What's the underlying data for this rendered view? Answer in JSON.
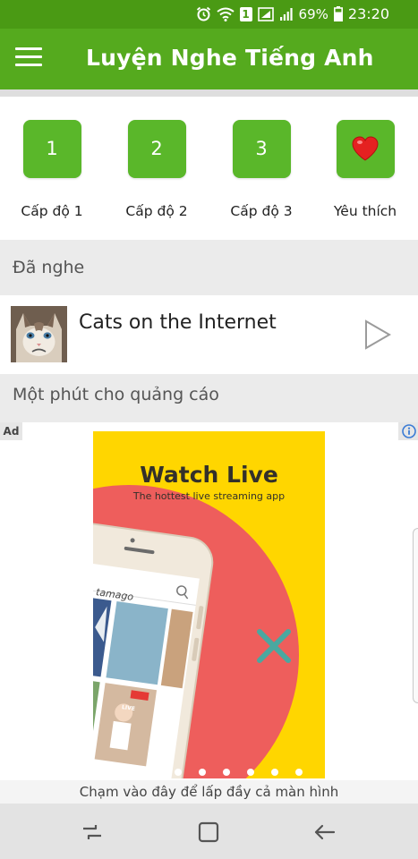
{
  "status_bar": {
    "battery": "69%",
    "time": "23:20",
    "sim_label": "1",
    "icons": [
      "alarm-icon",
      "wifi-icon",
      "sim-icon",
      "signal-icon",
      "battery-icon"
    ]
  },
  "app_bar": {
    "title": "Luyện Nghe Tiếng Anh",
    "menu_icon": "hamburger-menu-icon"
  },
  "levels": [
    {
      "tile": "1",
      "label": "Cấp độ 1"
    },
    {
      "tile": "2",
      "label": "Cấp độ 2"
    },
    {
      "tile": "3",
      "label": "Cấp độ 3"
    },
    {
      "tile_icon": "heart-icon",
      "label": "Yêu thích"
    }
  ],
  "listened": {
    "header": "Đã nghe",
    "item": {
      "title": "Cats on the Internet",
      "thumbnail": "cat-thumbnail",
      "action_icon": "play-icon"
    }
  },
  "ad_section": {
    "header": "Một phút cho quảng cáo",
    "badge": "Ad",
    "info_icon": "info-icon",
    "headline": "Watch Live",
    "subheadline": "The hottest live streaming app",
    "phone_search_text": "tamago",
    "phone_tag": "LIVE",
    "carousel_dots": 7,
    "caption": "Chạm vào đây để lấp đầy cả màn hình"
  },
  "nav_bar": {
    "buttons": [
      "recent-apps-icon",
      "home-icon",
      "back-icon"
    ]
  },
  "colors": {
    "status_bar": "#4a9a14",
    "app_bar": "#55aa1e",
    "tile": "#5ab72a",
    "ad_yellow": "#ffd600",
    "ad_coral": "#ee5e5c",
    "ad_teal": "#4aa8a0"
  }
}
